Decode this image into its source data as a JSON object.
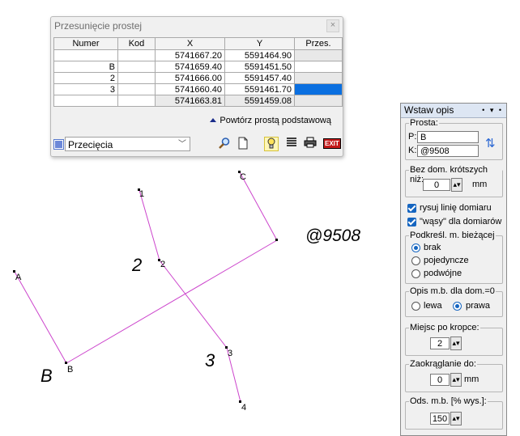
{
  "dialog": {
    "title": "Przesunięcie prostej",
    "close": "×",
    "columns": [
      "Numer",
      "Kod",
      "X",
      "Y",
      "Przes."
    ],
    "rows": [
      {
        "numer": "",
        "kod": "",
        "x": "5741667.20",
        "y": "5591464.90"
      },
      {
        "numer": "",
        "kod": "B",
        "x": "5741659.40",
        "y": "5591451.50"
      },
      {
        "numer": "",
        "kod": "2",
        "x": "5741666.00",
        "y": "5591457.40"
      },
      {
        "numer": "",
        "kod": "3",
        "x": "5741660.40",
        "y": "5591461.70"
      },
      {
        "numer": "",
        "kod": "",
        "x": "5741663.81",
        "y": "5591459.08"
      }
    ],
    "repeat_label": "Powtórz prostą podstawową",
    "combo_value": "Przecięcia",
    "exit_label": "EXIT"
  },
  "panel": {
    "title": "Wstaw opis",
    "header_controls": "• ▾ •",
    "prosta_label": "Prosta:",
    "p_label": "P:",
    "p_value": "B",
    "k_label": "K:",
    "k_value": "@9508",
    "bez_dom_label": "Bez dom. krótszych niż:",
    "bez_dom_value": "0",
    "bez_dom_unit": "mm",
    "rysuj_label": "rysuj linię domiaru",
    "wasy_label": "\"wąsy\" dla domiarów",
    "podkresl_label": "Podkreśl. m. bieżącej",
    "podkresl_options": [
      "brak",
      "pojedyncze",
      "podwójne"
    ],
    "opis_label": "Opis m.b. dla dom.=0",
    "opis_options": [
      "lewa",
      "prawa"
    ],
    "miejsc_label": "Miejsc po kropce:",
    "miejsc_value": "2",
    "zaokr_label": "Zaokrąglanie do:",
    "zaokr_value": "0",
    "zaokr_unit": "mm",
    "ods_label": "Ods. m.b. [% wys.]:",
    "ods_value": "150"
  },
  "canvas": {
    "points": [
      "A",
      "B",
      "1",
      "2",
      "3",
      "4",
      "C"
    ],
    "big_labels": [
      "B",
      "2",
      "3"
    ],
    "annotation": "@9508"
  },
  "colors": {
    "line_magenta": "#cc44cc",
    "selection_blue": "#0a6fe0",
    "panel_header": "#dde6f3"
  }
}
